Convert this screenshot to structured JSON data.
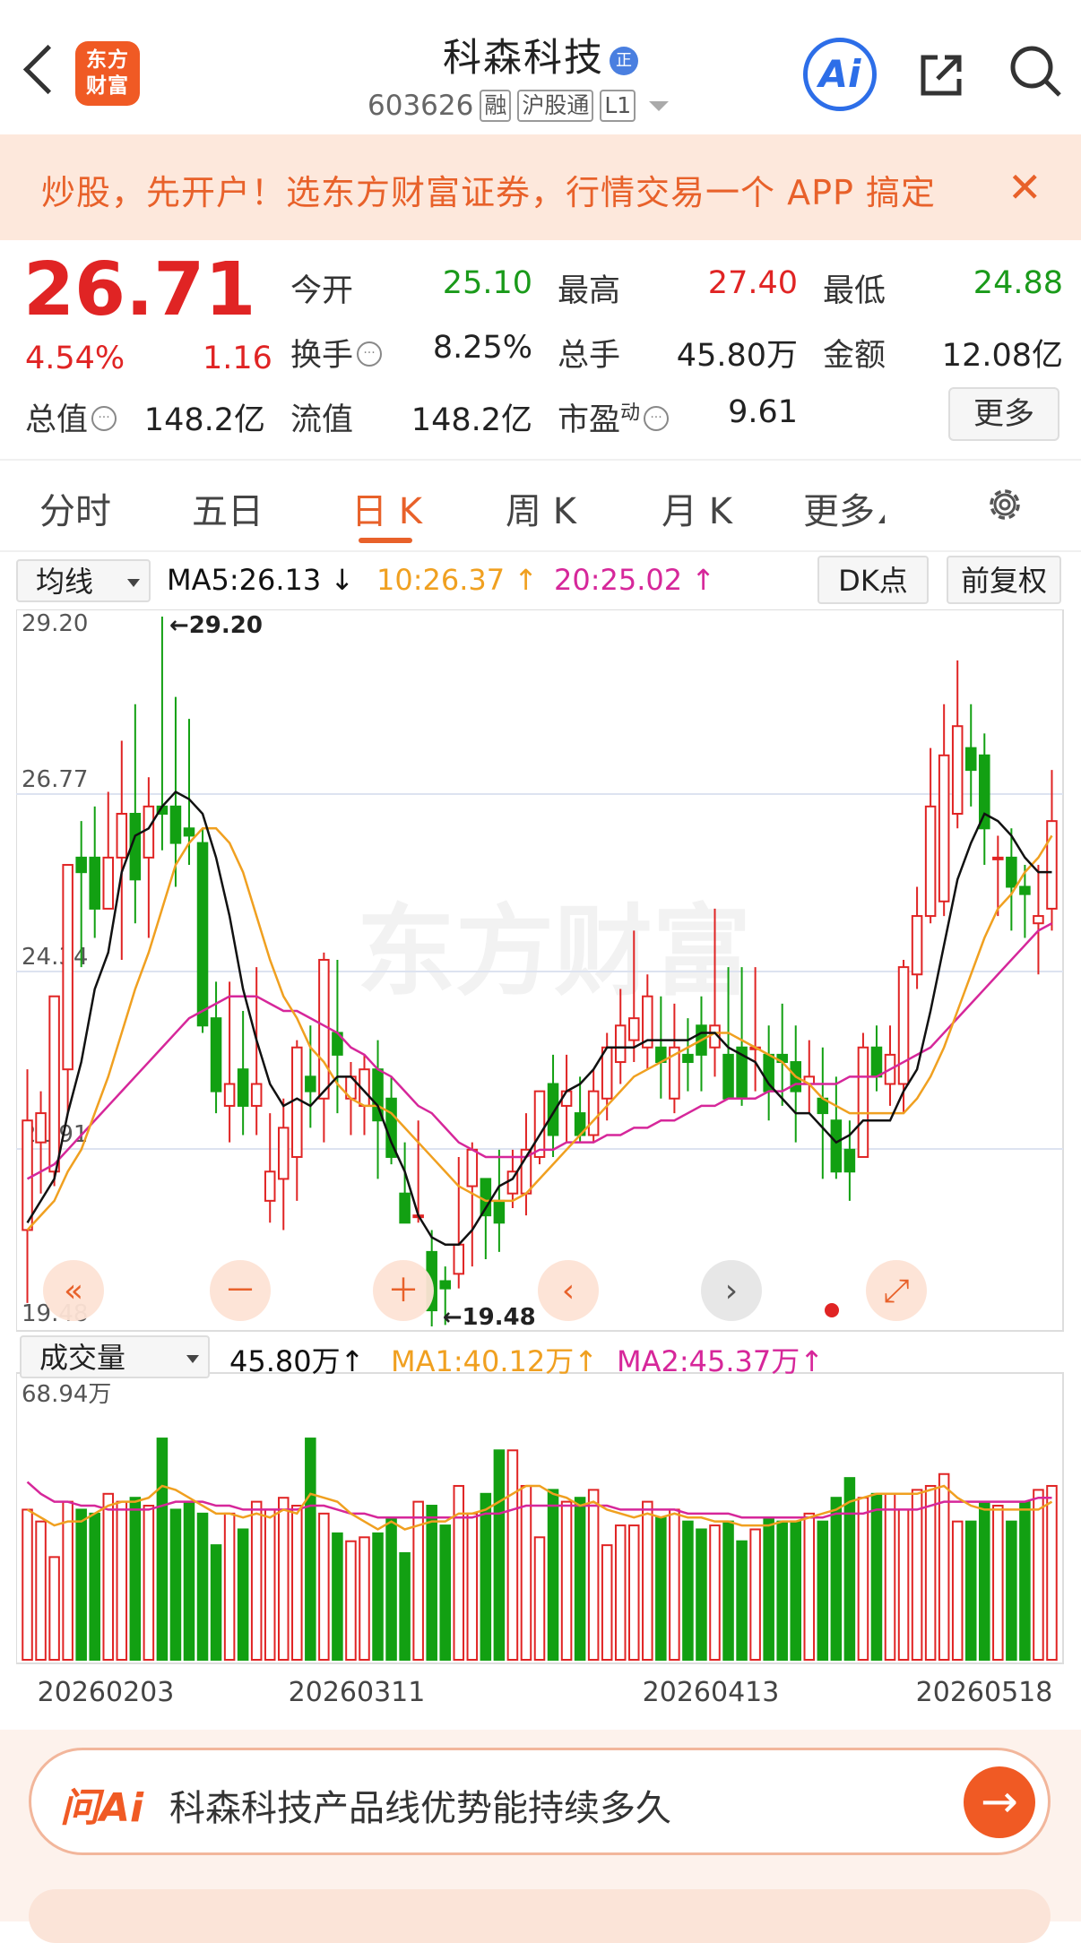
{
  "header": {
    "logo_text_line1": "东方",
    "logo_text_line2": "财富",
    "title": "科森科技",
    "title_badge": "正",
    "code": "603626",
    "tags": [
      "融",
      "沪股通",
      "L1"
    ],
    "ai_label": "Ai"
  },
  "banner": {
    "text": "炒股，先开户！选东方财富证券，行情交易一个 APP 搞定",
    "close": "✕"
  },
  "quote": {
    "price": "26.71",
    "change_pct": "4.54%",
    "change": "1.16",
    "rows": [
      [
        {
          "label": "今开",
          "value": "25.10",
          "color": "#1a9a1a"
        },
        {
          "label": "最高",
          "value": "27.40",
          "color": "#e02424"
        },
        {
          "label": "最低",
          "value": "24.88",
          "color": "#1a9a1a"
        }
      ],
      [
        {
          "label": "换手",
          "value": "8.25%",
          "color": "#222"
        },
        {
          "label": "总手",
          "value": "45.80万",
          "color": "#222"
        },
        {
          "label": "金额",
          "value": "12.08亿",
          "color": "#222"
        }
      ]
    ],
    "total_value_label": "总值",
    "total_value": "148.2亿",
    "float_label": "流值",
    "float_value": "148.2亿",
    "pe_label": "市盈",
    "pe_sup": "动",
    "pe_value": "9.61",
    "more": "更多"
  },
  "tabs": [
    "分时",
    "五日",
    "日 K",
    "周 K",
    "月 K",
    "更多"
  ],
  "ma_row": {
    "selector": "均线",
    "ma5": "MA5:26.13",
    "ma5_arrow": "↓",
    "ma10": "10:26.37",
    "ma10_arrow": "↑",
    "ma20": "20:25.02",
    "ma20_arrow": "↑",
    "dk": "DK点",
    "fq": "前复权"
  },
  "vol_row": {
    "selector": "成交量",
    "vol": "45.80万",
    "vol_arrow": "↑",
    "ma1": "MA1:40.12万",
    "ma1_arrow": "↑",
    "ma2": "MA2:45.37万",
    "ma2_arrow": "↑"
  },
  "controls": [
    "«",
    "－",
    "＋",
    "‹",
    "›",
    "⤢"
  ],
  "ai_bar": {
    "logo": "问Ai",
    "question": "科森科技产品线优势能持续多久",
    "go": "→"
  },
  "colors": {
    "up": "#e02424",
    "down": "#12a012",
    "ma5": "#111111",
    "ma10": "#f0a020",
    "ma20": "#d6279a",
    "accent": "#e8612a"
  },
  "chart_data": {
    "type": "candlestick",
    "price_axis_labels": [
      "29.20",
      "26.77",
      "24.34",
      "21.91",
      "19.48"
    ],
    "ylim": [
      19.48,
      29.2
    ],
    "high_marker": "←29.20",
    "low_marker": "←19.48",
    "date_labels": [
      "20260203",
      "20260311",
      "20260413",
      "20260518"
    ],
    "candles": [
      [
        20.8,
        22.3,
        23.0,
        19.8
      ],
      [
        22.0,
        22.4,
        22.7,
        21.3
      ],
      [
        21.6,
        24.0,
        24.0,
        21.4
      ],
      [
        23.0,
        25.8,
        25.8,
        22.4
      ],
      [
        25.9,
        25.7,
        26.4,
        24.4
      ],
      [
        25.9,
        25.2,
        26.6,
        24.8
      ],
      [
        25.2,
        25.9,
        26.8,
        25.2
      ],
      [
        25.9,
        26.5,
        27.5,
        24.5
      ],
      [
        26.5,
        25.6,
        28.0,
        25.0
      ],
      [
        25.9,
        26.6,
        27.0,
        24.8
      ],
      [
        26.6,
        26.5,
        29.2,
        26.0
      ],
      [
        26.6,
        26.1,
        28.1,
        25.5
      ],
      [
        26.3,
        26.2,
        27.8,
        25.8
      ],
      [
        26.1,
        23.6,
        26.3,
        23.5
      ],
      [
        23.7,
        22.7,
        24.2,
        22.4
      ],
      [
        22.5,
        22.8,
        24.2,
        22.0
      ],
      [
        23.0,
        22.5,
        23.8,
        22.1
      ],
      [
        22.5,
        22.8,
        24.4,
        22.1
      ],
      [
        21.2,
        21.6,
        22.4,
        20.9
      ],
      [
        21.5,
        22.2,
        22.6,
        20.8
      ],
      [
        21.8,
        23.3,
        23.4,
        21.2
      ],
      [
        22.9,
        22.7,
        23.6,
        22.2
      ],
      [
        22.6,
        24.5,
        24.6,
        22.0
      ],
      [
        23.5,
        23.2,
        24.5,
        22.4
      ],
      [
        22.6,
        22.9,
        23.1,
        22.1
      ],
      [
        22.5,
        23.0,
        23.2,
        22.1
      ],
      [
        23.0,
        22.3,
        23.4,
        21.5
      ],
      [
        22.6,
        21.8,
        22.9,
        21.7
      ],
      [
        21.3,
        20.9,
        22.0,
        20.9
      ],
      [
        21.0,
        21.0,
        22.3,
        20.9
      ],
      [
        20.5,
        19.7,
        20.8,
        19.48
      ],
      [
        20.1,
        20.0,
        20.3,
        19.5
      ],
      [
        20.2,
        20.6,
        21.8,
        20.0
      ],
      [
        21.4,
        21.9,
        22.0,
        20.3
      ],
      [
        21.5,
        21.0,
        21.5,
        20.4
      ],
      [
        21.2,
        20.9,
        21.9,
        20.5
      ],
      [
        21.3,
        21.6,
        21.9,
        21.1
      ],
      [
        21.3,
        21.9,
        22.4,
        21.0
      ],
      [
        21.8,
        22.7,
        22.7,
        21.7
      ],
      [
        22.8,
        22.1,
        23.2,
        21.8
      ],
      [
        22.5,
        22.7,
        23.2,
        22.0
      ],
      [
        22.4,
        22.1,
        22.9,
        22.0
      ],
      [
        22.1,
        22.7,
        23.0,
        22.0
      ],
      [
        22.6,
        23.3,
        23.5,
        22.3
      ],
      [
        23.1,
        23.6,
        24.1,
        22.8
      ],
      [
        23.4,
        23.7,
        24.9,
        23.1
      ],
      [
        23.3,
        24.0,
        24.3,
        23.0
      ],
      [
        23.3,
        23.1,
        24.0,
        22.6
      ],
      [
        22.6,
        23.3,
        23.9,
        22.4
      ],
      [
        23.2,
        23.1,
        23.7,
        22.7
      ],
      [
        23.6,
        23.2,
        24.0,
        22.7
      ],
      [
        23.3,
        23.6,
        25.2,
        22.9
      ],
      [
        23.2,
        22.6,
        24.4,
        22.6
      ],
      [
        23.3,
        22.6,
        24.4,
        22.5
      ],
      [
        23.3,
        23.3,
        24.4,
        22.7
      ],
      [
        23.2,
        22.7,
        23.6,
        22.3
      ],
      [
        23.2,
        23.1,
        23.9,
        22.5
      ],
      [
        23.1,
        22.7,
        23.6,
        22.0
      ],
      [
        22.8,
        22.9,
        23.4,
        22.4
      ],
      [
        22.6,
        22.4,
        23.3,
        21.5
      ],
      [
        22.3,
        21.6,
        22.9,
        21.5
      ],
      [
        21.9,
        21.6,
        22.3,
        21.2
      ],
      [
        21.8,
        23.3,
        23.5,
        21.8
      ],
      [
        23.3,
        22.9,
        23.6,
        22.7
      ],
      [
        22.8,
        23.2,
        23.6,
        22.5
      ],
      [
        22.8,
        24.4,
        24.5,
        22.4
      ],
      [
        24.3,
        25.1,
        25.5,
        24.1
      ],
      [
        25.1,
        26.6,
        27.4,
        25.0
      ],
      [
        25.3,
        27.3,
        28.0,
        25.1
      ],
      [
        26.5,
        27.7,
        28.6,
        26.3
      ],
      [
        27.4,
        27.1,
        28.0,
        26.6
      ],
      [
        27.3,
        26.3,
        27.6,
        25.8
      ],
      [
        25.9,
        25.9,
        26.2,
        25.1
      ],
      [
        25.9,
        25.5,
        26.3,
        24.9
      ],
      [
        25.5,
        25.4,
        25.8,
        24.8
      ],
      [
        25.0,
        25.1,
        25.8,
        24.3
      ],
      [
        25.2,
        26.4,
        27.1,
        24.9
      ]
    ],
    "ma5": [
      20.9,
      21.2,
      21.5,
      22.4,
      23.1,
      24.1,
      24.6,
      25.7,
      26.2,
      26.3,
      26.6,
      26.8,
      26.7,
      26.5,
      25.9,
      25.1,
      24.1,
      23.4,
      22.8,
      22.5,
      22.6,
      22.5,
      22.7,
      22.9,
      22.9,
      22.7,
      22.5,
      22.0,
      21.6,
      21.0,
      20.7,
      20.6,
      20.6,
      20.8,
      21.1,
      21.4,
      21.5,
      21.8,
      22.1,
      22.4,
      22.7,
      22.8,
      23.0,
      23.3,
      23.3,
      23.3,
      23.4,
      23.4,
      23.4,
      23.4,
      23.5,
      23.5,
      23.3,
      23.2,
      23.1,
      22.8,
      22.6,
      22.4,
      22.4,
      22.2,
      22.0,
      22.1,
      22.3,
      22.3,
      22.3,
      22.7,
      23.0,
      23.8,
      24.7,
      25.6,
      26.1,
      26.5,
      26.4,
      26.2,
      25.9,
      25.7,
      25.7
    ],
    "ma10": [
      20.8,
      21.0,
      21.2,
      21.6,
      21.9,
      22.4,
      22.9,
      23.5,
      24.1,
      24.6,
      25.2,
      25.8,
      26.1,
      26.3,
      26.3,
      26.1,
      25.7,
      25.1,
      24.5,
      24.0,
      23.7,
      23.3,
      23.1,
      22.8,
      22.6,
      22.5,
      22.5,
      22.4,
      22.2,
      22.0,
      21.8,
      21.6,
      21.4,
      21.3,
      21.2,
      21.2,
      21.2,
      21.3,
      21.5,
      21.7,
      21.9,
      22.1,
      22.3,
      22.5,
      22.7,
      22.9,
      23.0,
      23.1,
      23.2,
      23.3,
      23.4,
      23.5,
      23.5,
      23.4,
      23.3,
      23.2,
      23.1,
      22.9,
      22.8,
      22.6,
      22.5,
      22.4,
      22.4,
      22.4,
      22.4,
      22.4,
      22.6,
      22.9,
      23.3,
      23.8,
      24.3,
      24.8,
      25.2,
      25.4,
      25.7,
      25.9,
      26.2
    ],
    "ma20": [
      21.5,
      21.6,
      21.7,
      21.9,
      22.1,
      22.3,
      22.5,
      22.7,
      22.9,
      23.1,
      23.3,
      23.5,
      23.7,
      23.8,
      23.9,
      24.0,
      24.0,
      24.0,
      23.9,
      23.8,
      23.8,
      23.7,
      23.6,
      23.5,
      23.3,
      23.2,
      23.0,
      22.9,
      22.7,
      22.5,
      22.4,
      22.2,
      22.0,
      21.9,
      21.8,
      21.8,
      21.8,
      21.8,
      21.9,
      21.9,
      22.0,
      22.0,
      22.0,
      22.1,
      22.1,
      22.2,
      22.2,
      22.3,
      22.3,
      22.4,
      22.5,
      22.5,
      22.6,
      22.6,
      22.6,
      22.7,
      22.7,
      22.8,
      22.8,
      22.8,
      22.8,
      22.9,
      22.9,
      22.9,
      23.0,
      23.1,
      23.2,
      23.3,
      23.5,
      23.7,
      23.9,
      24.1,
      24.3,
      24.5,
      24.7,
      24.9,
      25.0
    ],
    "volume_axis_label": "68.94万",
    "volume_max": 68.94,
    "volume": [
      38,
      35,
      26,
      40,
      38,
      37,
      42,
      40,
      41,
      39,
      56,
      38,
      40,
      37,
      29,
      37,
      33,
      40,
      38,
      41,
      39,
      56,
      37,
      32,
      30,
      31,
      32,
      36,
      27,
      40,
      39,
      34,
      44,
      37,
      42,
      53,
      53,
      44,
      31,
      43,
      40,
      41,
      43,
      29,
      34,
      34,
      40,
      36,
      38,
      35,
      33,
      34,
      35,
      30,
      33,
      36,
      35,
      35,
      37,
      35,
      41,
      46,
      41,
      42,
      42,
      38,
      43,
      44,
      47,
      35,
      35,
      40,
      39,
      35,
      40,
      43,
      44
    ],
    "vol_ma1": [
      38,
      36,
      34,
      35,
      35,
      37,
      39,
      40,
      40,
      41,
      44,
      43,
      41,
      39,
      37,
      37,
      36,
      37,
      36,
      38,
      37,
      42,
      41,
      40,
      37,
      35,
      33,
      35,
      33,
      34,
      35,
      35,
      37,
      37,
      38,
      40,
      42,
      44,
      44,
      42,
      41,
      39,
      40,
      38,
      37,
      36,
      37,
      36,
      37,
      36,
      36,
      35,
      35,
      34,
      34,
      34,
      35,
      35,
      36,
      37,
      38,
      40,
      41,
      42,
      42,
      42,
      42,
      43,
      44,
      41,
      39,
      38,
      38,
      38,
      38,
      38,
      40
    ],
    "vol_ma2": [
      45,
      42,
      40,
      40,
      39,
      39,
      38,
      38,
      38,
      38,
      39,
      40,
      40,
      40,
      39,
      39,
      38,
      38,
      38,
      38,
      38,
      39,
      39,
      38,
      37,
      37,
      36,
      36,
      36,
      36,
      36,
      36,
      36,
      36,
      37,
      37,
      38,
      39,
      39,
      39,
      39,
      39,
      39,
      39,
      38,
      38,
      38,
      38,
      38,
      37,
      37,
      37,
      37,
      36,
      36,
      36,
      36,
      36,
      36,
      36,
      37,
      37,
      37,
      38,
      38,
      38,
      38,
      39,
      40,
      40,
      40,
      40,
      40,
      40,
      40,
      41,
      41
    ]
  },
  "watermark": "东方财富"
}
